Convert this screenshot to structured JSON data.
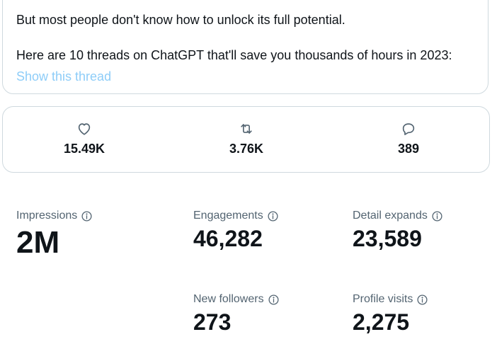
{
  "tweet": {
    "line1": "But most people don't know how to unlock its full potential.",
    "line2": "Here are 10 threads on ChatGPT that'll save you thousands of hours in 2023:",
    "show_thread": "Show this thread"
  },
  "engagement": {
    "likes": "15.49K",
    "retweets": "3.76K",
    "replies": "389"
  },
  "metrics": {
    "impressions": {
      "label": "Impressions",
      "value": "2M"
    },
    "engagements": {
      "label": "Engagements",
      "value": "46,282"
    },
    "detail_expands": {
      "label": "Detail expands",
      "value": "23,589"
    },
    "new_followers": {
      "label": "New followers",
      "value": "273"
    },
    "profile_visits": {
      "label": "Profile visits",
      "value": "2,275"
    }
  },
  "colors": {
    "text": "#0f1419",
    "secondary": "#536471",
    "border": "#cfd9de",
    "link": "#8ecdf8"
  },
  "icons": {
    "likes": "heart-icon",
    "retweets": "retweet-icon",
    "replies": "reply-icon",
    "info": "info-icon"
  }
}
